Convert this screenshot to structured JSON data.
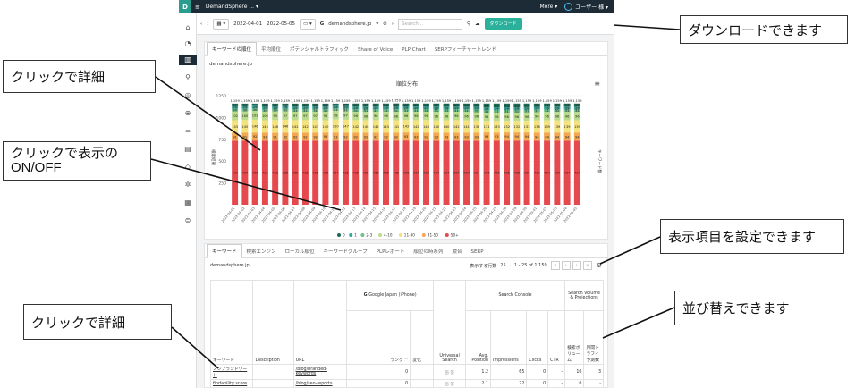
{
  "topbar": {
    "logo": "D",
    "menu_icon": "menu-icon",
    "project": "DemandSphere ... ▾",
    "more": "More ▾",
    "user": "ユーザー 様 ▾"
  },
  "toolbar": {
    "date_start": "2022-04-01",
    "date_end": "2022-05-05",
    "search_engine": "G",
    "domain": "demandsphere.jp",
    "search_placeholder": "Search...",
    "download_button": "ダウンロード"
  },
  "chart_card": {
    "tabs": [
      "キーワードの順位",
      "平均順位",
      "ポテンシャルトラフィック",
      "Share of Voice",
      "PLP Chart",
      "SERPフィーチャートレンド"
    ],
    "domain": "demandsphere.jp",
    "chart_title": "順位分布"
  },
  "chart_data": {
    "type": "bar",
    "title": "順位分布",
    "ylabel": "検索結果",
    "y2label": "キーワード数",
    "ylim": [
      0,
      1250
    ],
    "yticks": [
      250,
      500,
      750,
      1000,
      1250
    ],
    "categories": [
      "2022-04-01",
      "2022-04-02",
      "2022-04-03",
      "2022-04-04",
      "2022-04-05",
      "2022-04-06",
      "2022-04-07",
      "2022-04-08",
      "2022-04-09",
      "2022-04-10",
      "2022-04-11",
      "2022-04-12",
      "2022-04-13",
      "2022-04-14",
      "2022-04-15",
      "2022-04-16",
      "2022-04-17",
      "2022-04-18",
      "2022-04-19",
      "2022-04-20",
      "2022-04-21",
      "2022-04-22",
      "2022-04-23",
      "2022-04-24",
      "2022-04-25",
      "2022-04-26",
      "2022-04-27",
      "2022-04-28",
      "2022-04-29",
      "2022-04-30",
      "2022-05-01",
      "2022-05-02",
      "2022-05-03",
      "2022-05-04",
      "2022-05-05"
    ],
    "total_label": "1,159",
    "series": [
      {
        "name": "50+",
        "color": "#e5484d",
        "values": [
          734,
          734,
          736,
          734,
          733,
          735,
          735,
          735,
          735,
          735,
          734,
          735,
          735,
          735,
          735,
          735,
          735,
          736,
          734,
          734,
          734,
          734,
          734,
          734,
          734,
          736,
          735,
          735,
          735,
          735,
          734,
          734,
          734,
          734,
          734
        ]
      },
      {
        "name": "31-50",
        "color": "#f3a74f",
        "values": [
          91,
          91,
          92,
          91,
          91,
          92,
          92,
          92,
          92,
          93,
          93,
          92,
          92,
          92,
          92,
          92,
          92,
          93,
          93,
          93,
          93,
          93,
          93,
          93,
          93,
          93,
          93,
          94,
          94,
          94,
          94,
          94,
          94,
          94,
          94
        ]
      },
      {
        "name": "11-30",
        "color": "#f4e27c",
        "values": [
          143,
          145,
          146,
          143,
          146,
          146,
          142,
          142,
          143,
          140,
          150,
          147,
          142,
          140,
          142,
          143,
          141,
          142,
          142,
          143,
          140,
          140,
          142,
          141,
          138,
          131,
          133,
          132,
          132,
          133,
          138,
          139,
          139,
          139,
          139
        ]
      },
      {
        "name": "4-10",
        "color": "#b9dc8a",
        "values": [
          102,
          100,
          102,
          100,
          99,
          97,
          97,
          97,
          97,
          98,
          98,
          97,
          96,
          96,
          96,
          96,
          96,
          96,
          96,
          96,
          96,
          96,
          96,
          96,
          96,
          96,
          96,
          96,
          96,
          96,
          96,
          96,
          96,
          96,
          96
        ]
      },
      {
        "name": "2-3",
        "color": "#6fc08a",
        "values": [
          30,
          30,
          30,
          30,
          30,
          31,
          31,
          31,
          31,
          31,
          31,
          31,
          31,
          31,
          31,
          31,
          31,
          31,
          31,
          31,
          31,
          31,
          31,
          31,
          31,
          31,
          31,
          31,
          31,
          31,
          31,
          31,
          31,
          31,
          31
        ]
      },
      {
        "name": "1",
        "color": "#3aa59a",
        "values": [
          29,
          29,
          29,
          29,
          29,
          29,
          29,
          29,
          29,
          29,
          29,
          29,
          29,
          29,
          29,
          29,
          29,
          29,
          29,
          29,
          29,
          29,
          29,
          29,
          29,
          29,
          29,
          29,
          29,
          29,
          29,
          29,
          29,
          29,
          29
        ]
      },
      {
        "name": "0",
        "color": "#1d6b55",
        "values": [
          30,
          30,
          24,
          32,
          31,
          29,
          33,
          33,
          32,
          33,
          24,
          28,
          35,
          37,
          35,
          34,
          37,
          33,
          35,
          34,
          37,
          37,
          35,
          36,
          39,
          44,
          43,
          43,
          43,
          42,
          38,
          37,
          37,
          37,
          37
        ]
      }
    ],
    "legend": [
      "0",
      "1",
      "2-3",
      "4-10",
      "11-30",
      "31-50",
      "50+"
    ],
    "legend_position": "bottom"
  },
  "table_card": {
    "tabs": [
      "キーワード",
      "検索エンジン",
      "ローカル順位",
      "キーワードグループ",
      "PLPレポート",
      "順位の時系列",
      "競合",
      "SERP"
    ],
    "domain": "demandsphere.jp",
    "rows_per_page_label": "表示する行数",
    "rows_per_page": "25",
    "range_label": "1 - 25 of 1,159",
    "pager": [
      "«",
      "‹",
      "›",
      "»"
    ],
    "headers": {
      "keyword": "キーワード",
      "description": "Description",
      "url": "URL",
      "engine": "Google Japan (iPhone)",
      "rank": "ランク ^",
      "change": "変化",
      "universal": "Universal Search",
      "search_console": "Search Console",
      "avg_position": "Avg. Position",
      "impressions": "Impressions",
      "clicks": "Clicks",
      "ctr": "CTR",
      "volume_group": "Search Volume & Projections",
      "search_volume": "検索ボリューム",
      "monthly_traffic": "月間トラフィ 予測数"
    },
    "rows": [
      {
        "keyword": "ノンブランドワード",
        "description": "",
        "url": "/blog/branded-keywords",
        "rank": "0",
        "change": "",
        "universal": "画 答",
        "avg_position": "1.2",
        "impressions": "65",
        "clicks": "0",
        "ctr": "-",
        "search_volume": "10",
        "monthly_traffic": "3"
      },
      {
        "keyword": "findability score",
        "description": "",
        "url": "/blog/seo-reports",
        "rank": "0",
        "change": "",
        "universal": "画 答",
        "avg_position": "2.1",
        "impressions": "22",
        "clicks": "0",
        "ctr": "-",
        "search_volume": "0",
        "monthly_traffic": "-"
      }
    ]
  },
  "callouts": {
    "download": "ダウンロードできます",
    "click_detail_1": "クリックで詳細",
    "toggle_display": "クリックで表示の\nON/OFF",
    "configure_columns": "表示項目を設定できます",
    "sortable": "並び替えできます",
    "click_detail_2": "クリックで詳細"
  }
}
